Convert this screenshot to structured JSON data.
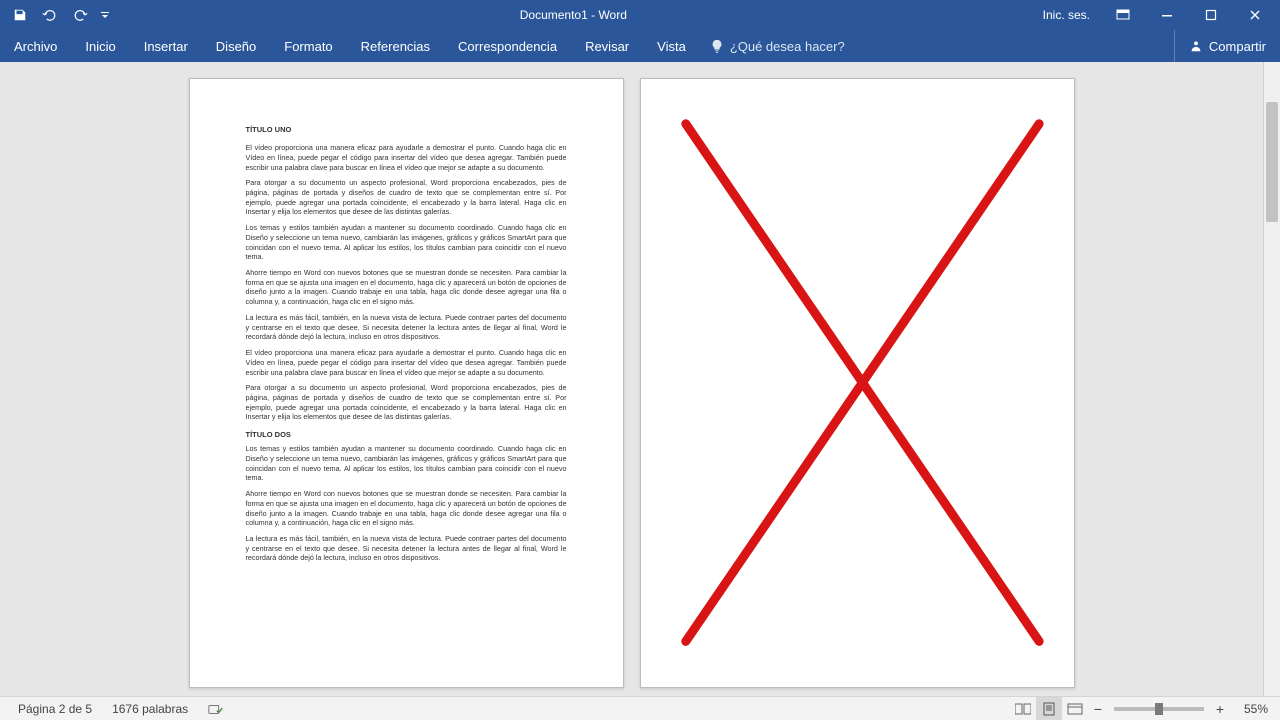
{
  "titlebar": {
    "document_title": "Documento1  -  Word",
    "signin": "Inic. ses."
  },
  "ribbon": {
    "tabs": [
      "Archivo",
      "Inicio",
      "Insertar",
      "Diseño",
      "Formato",
      "Referencias",
      "Correspondencia",
      "Revisar",
      "Vista"
    ],
    "tellme_placeholder": "¿Qué desea hacer?",
    "share": "Compartir"
  },
  "document": {
    "title1": "TÍTULO UNO",
    "p1": "El vídeo proporciona una manera eficaz para ayudarle a demostrar el punto. Cuando haga clic en Vídeo en línea, puede pegar el código para insertar del vídeo que desea agregar. También puede escribir una palabra clave para buscar en línea el vídeo que mejor se adapte a su documento.",
    "p2": "Para otorgar a su documento un aspecto profesional, Word proporciona encabezados, pies de página, páginas de portada y diseños de cuadro de texto que se complementan entre sí. Por ejemplo, puede agregar una portada coincidente, el encabezado y la barra lateral. Haga clic en Insertar y elija los elementos que desee de las distintas galerías.",
    "p3": "Los temas y estilos también ayudan a mantener su documento coordinado. Cuando haga clic en Diseño y seleccione un tema nuevo, cambiarán las imágenes, gráficos y gráficos SmartArt para que coincidan con el nuevo tema. Al aplicar los estilos, los títulos cambian para coincidir con el nuevo tema.",
    "p4": "Ahorre tiempo en Word con nuevos botones que se muestran donde se necesiten. Para cambiar la forma en que se ajusta una imagen en el documento, haga clic y aparecerá un botón de opciones de diseño junto a la imagen. Cuando trabaje en una tabla, haga clic donde desee agregar una fila o columna y, a continuación, haga clic en el signo más.",
    "p5": "La lectura es más fácil, también, en la nueva vista de lectura. Puede contraer partes del documento y centrarse en el texto que desee. Si necesita detener la lectura antes de llegar al final, Word le recordará dónde dejó la lectura, incluso en otros dispositivos.",
    "title2": "TÍTULO DOS"
  },
  "statusbar": {
    "page": "Página 2 de 5",
    "words": "1676 palabras",
    "zoom": "55%"
  }
}
